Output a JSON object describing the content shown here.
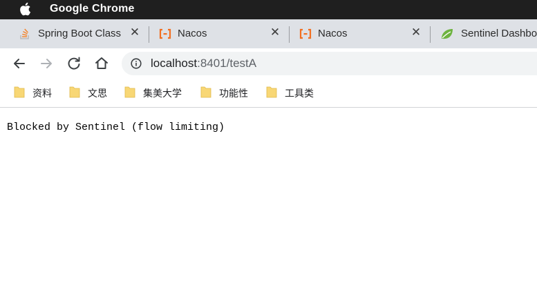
{
  "menubar": {
    "app_name": "Google Chrome"
  },
  "tabs": [
    {
      "title": "Spring Boot Class",
      "icon": "stackoverflow-icon"
    },
    {
      "title": "Nacos",
      "icon": "nacos-icon"
    },
    {
      "title": "Nacos",
      "icon": "nacos-icon"
    },
    {
      "title": "Sentinel Dashbo",
      "icon": "sentinel-leaf-icon"
    }
  ],
  "toolbar": {
    "url_host": "localhost",
    "url_rest": ":8401/testA"
  },
  "bookmarks": [
    {
      "label": "资料"
    },
    {
      "label": "文思"
    },
    {
      "label": "集美大学"
    },
    {
      "label": "功能性"
    },
    {
      "label": "工具类"
    }
  ],
  "page": {
    "message": "Blocked by Sentinel (flow limiting)"
  },
  "colors": {
    "menubar": "#1f1f1f",
    "tabstrip": "#dee1e6",
    "omnibox": "#f1f3f4",
    "nacos_orange": "#f26f21",
    "folder_yellow": "#f8d775"
  }
}
